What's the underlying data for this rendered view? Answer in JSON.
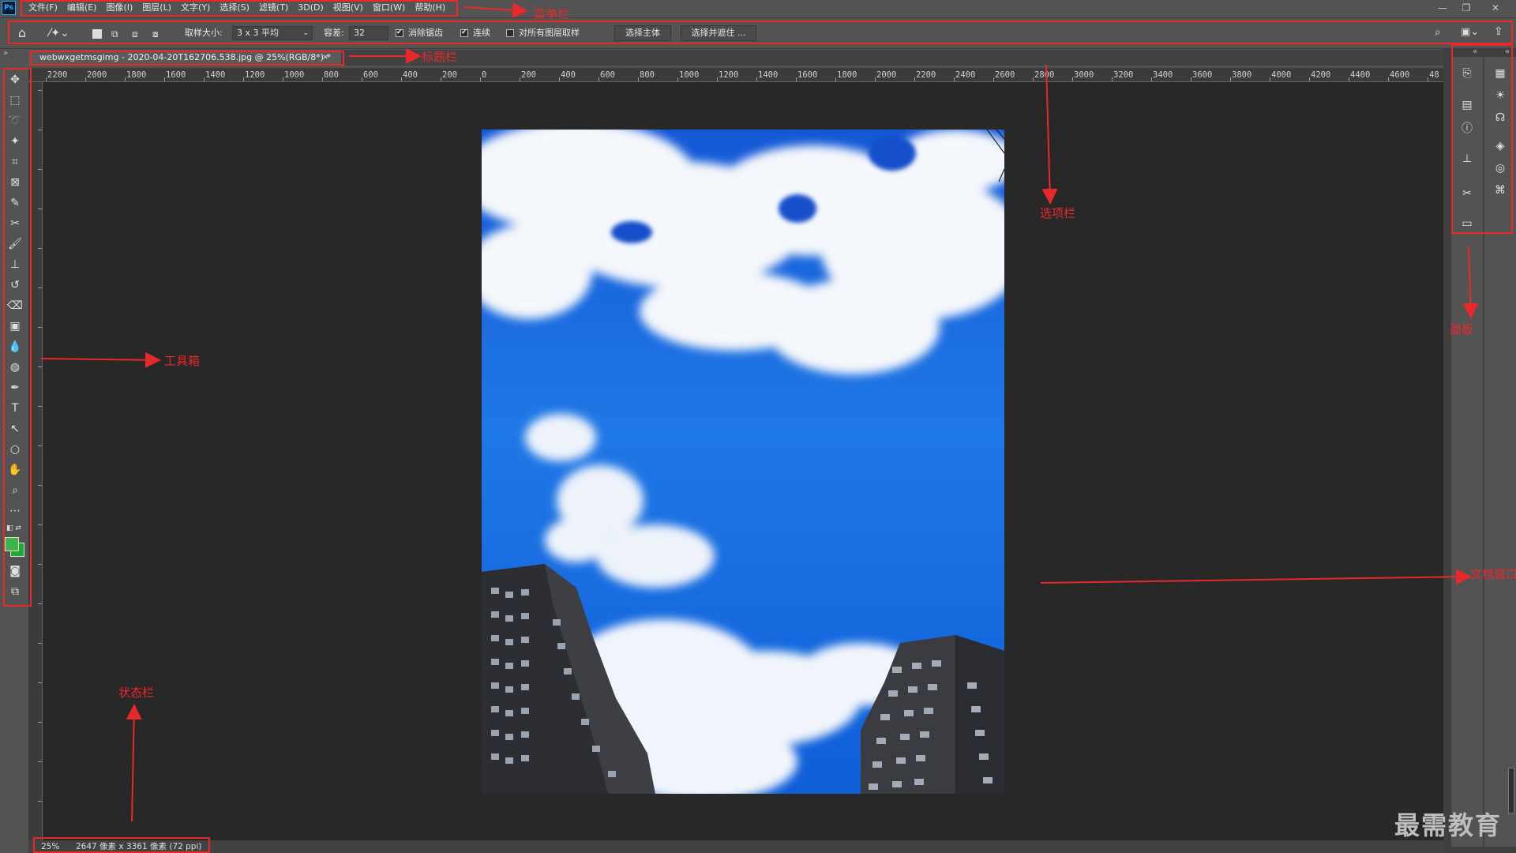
{
  "app": {
    "logo": "Ps",
    "menu": [
      "文件(F)",
      "编辑(E)",
      "图像(I)",
      "图层(L)",
      "文字(Y)",
      "选择(S)",
      "滤镜(T)",
      "3D(D)",
      "视图(V)",
      "窗口(W)",
      "帮助(H)"
    ],
    "window_controls": [
      "minimize-icon",
      "restore-icon",
      "close-icon"
    ]
  },
  "options_bar": {
    "sample_size_label": "取样大小:",
    "sample_size_value": "3 x 3 平均",
    "tolerance_label": "容差:",
    "tolerance_value": "32",
    "antialias_label": "消除锯齿",
    "antialias_checked": true,
    "contiguous_label": "连续",
    "contiguous_checked": true,
    "all_layers_label": "对所有图层取样",
    "all_layers_checked": false,
    "select_subject_label": "选择主体",
    "select_mask_label": "选择并遮住 ..."
  },
  "document": {
    "tab_title": "webwxgetmsgimg - 2020-04-20T162706.538.jpg @ 25%(RGB/8*) *",
    "close_glyph": "×"
  },
  "rulers": {
    "horizontal_labels": [
      "2200",
      "2000",
      "1800",
      "1600",
      "1400",
      "1200",
      "1000",
      "800",
      "600",
      "400",
      "200",
      "0",
      "200",
      "400",
      "600",
      "800",
      "1000",
      "1200",
      "1400",
      "1600",
      "1800",
      "2000",
      "2200",
      "2400",
      "2600",
      "2800",
      "3000",
      "3200",
      "3400",
      "3600",
      "3800",
      "4000",
      "4200",
      "4400",
      "4600",
      "48"
    ]
  },
  "status_bar": {
    "zoom": "25%",
    "doc_size": "2647 像素 x 3361 像素 (72 ppi)"
  },
  "annotations": {
    "menubar": "菜单栏",
    "title_bar": "标题栏",
    "options_bar": "选项栏",
    "toolbox": "工具箱",
    "panels": "面板",
    "doc_window": "文档窗口",
    "status_bar": "状态栏"
  },
  "colors": {
    "annotation_red": "#e8292b",
    "foreground": "#3db54a",
    "background": "#22a834"
  },
  "watermark": "最需教育"
}
